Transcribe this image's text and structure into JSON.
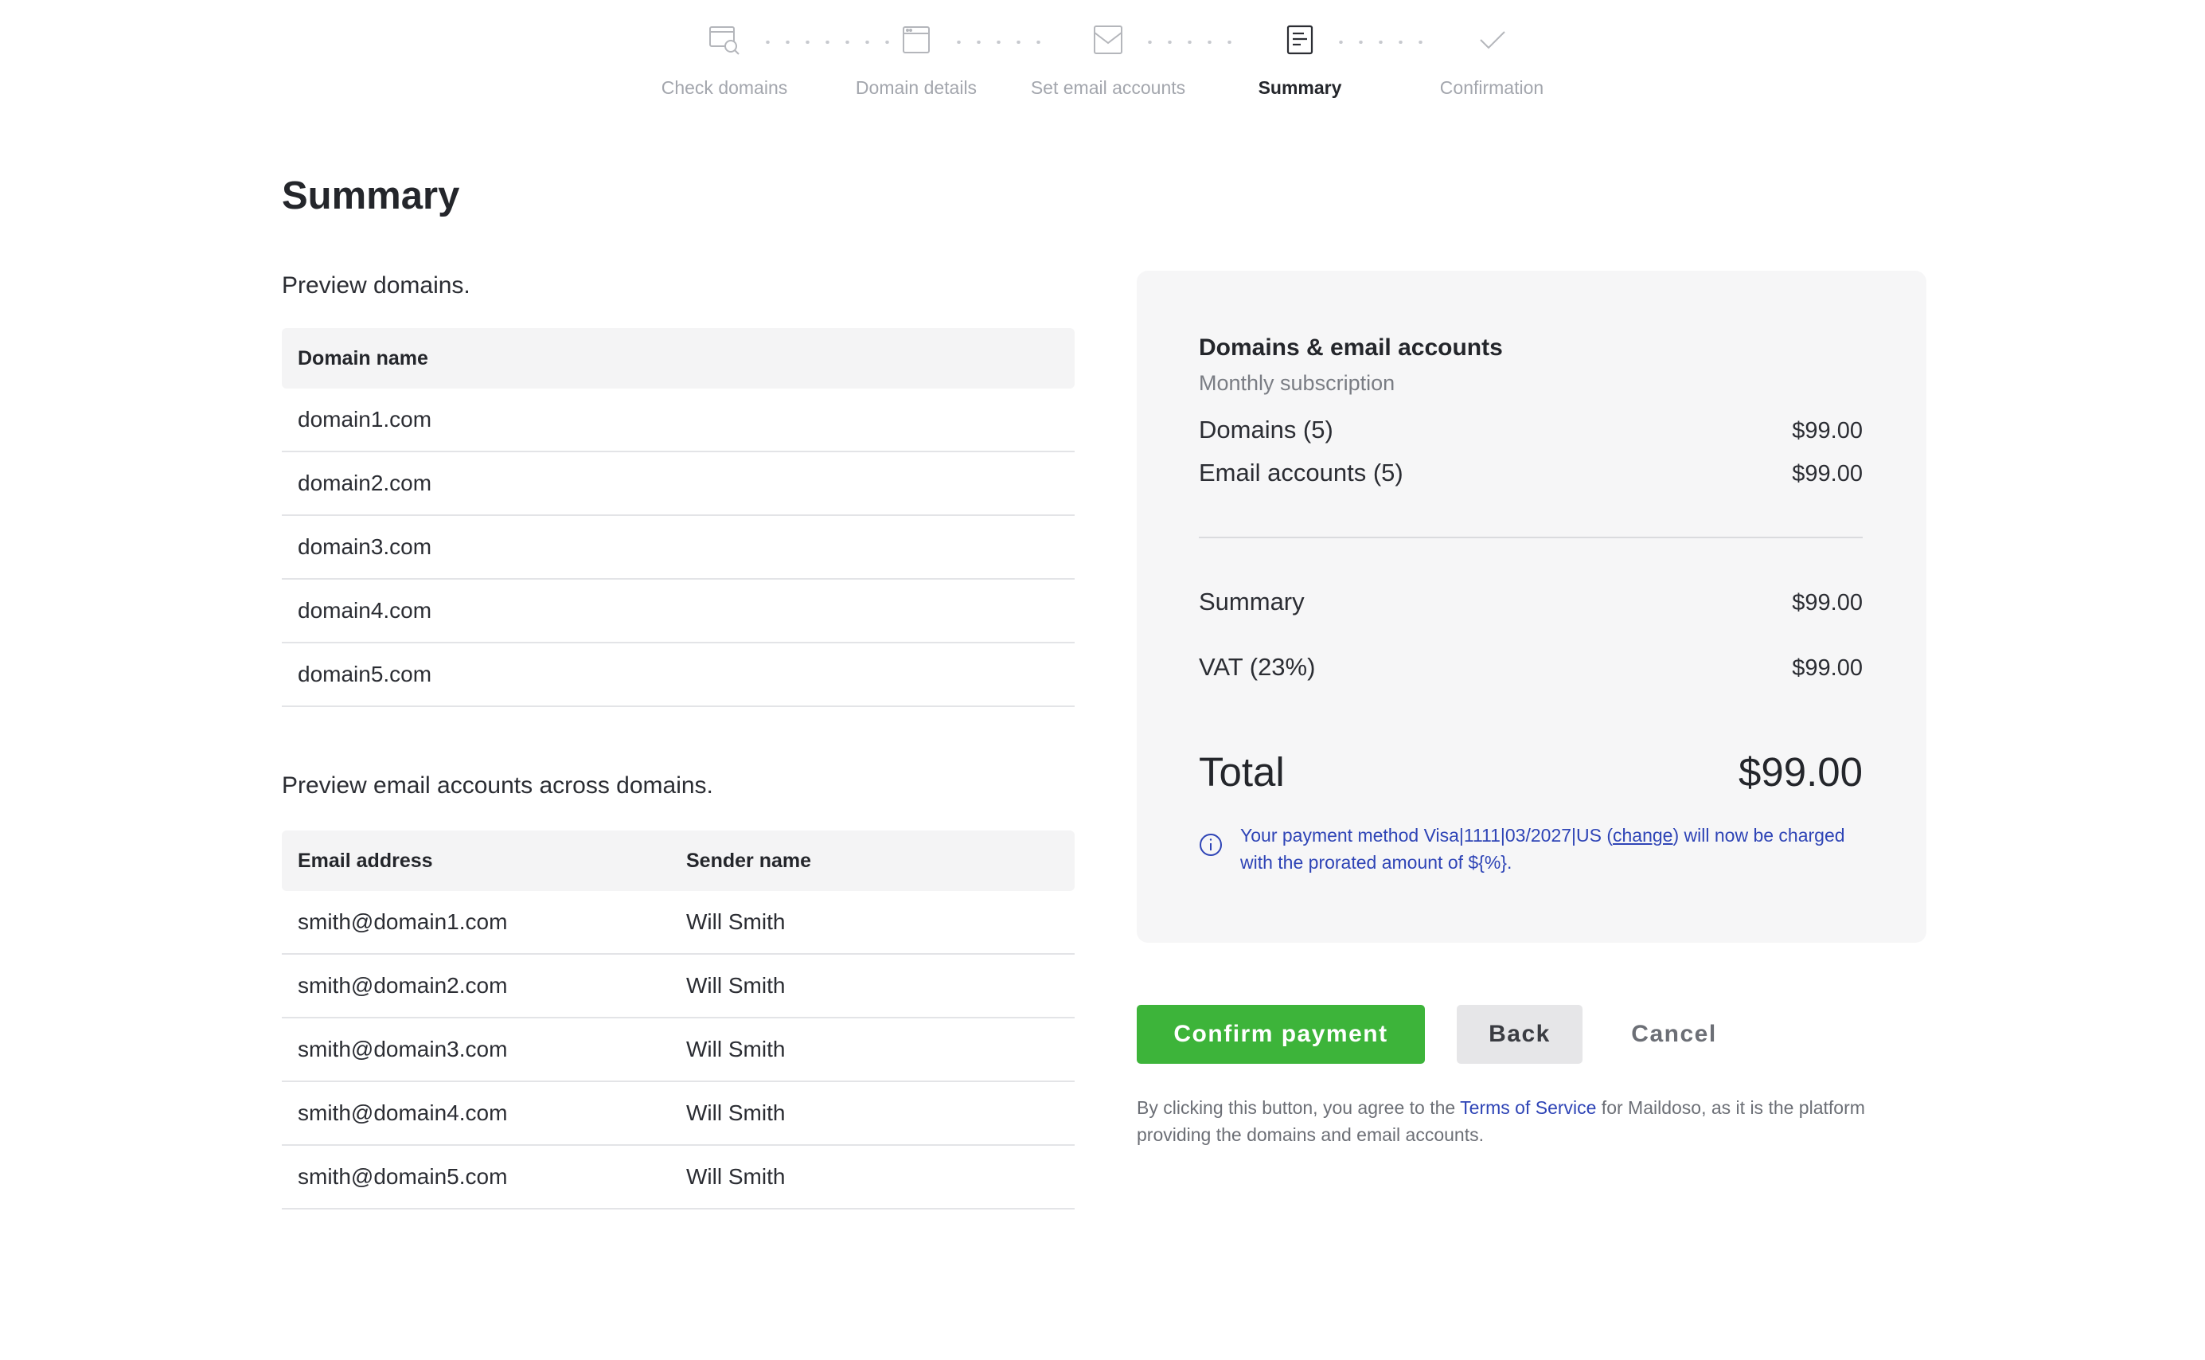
{
  "stepper": {
    "steps": [
      {
        "label": "Check domains",
        "icon": "domain-search-icon",
        "state": "done"
      },
      {
        "label": "Domain details",
        "icon": "browser-window-icon",
        "state": "done"
      },
      {
        "label": "Set email accounts",
        "icon": "mail-icon",
        "state": "done"
      },
      {
        "label": "Summary",
        "icon": "document-icon",
        "state": "active"
      },
      {
        "label": "Confirmation",
        "icon": "checkmark-icon",
        "state": "pending"
      }
    ]
  },
  "page": {
    "title": "Summary"
  },
  "domains_section": {
    "label": "Preview domains.",
    "column_header": "Domain name",
    "rows": [
      "domain1.com",
      "domain2.com",
      "domain3.com",
      "domain4.com",
      "domain5.com"
    ]
  },
  "emails_section": {
    "label": "Preview email accounts across domains.",
    "columns": [
      "Email address",
      "Sender name"
    ],
    "rows": [
      [
        "smith@domain1.com",
        "Will Smith"
      ],
      [
        "smith@domain2.com",
        "Will Smith"
      ],
      [
        "smith@domain3.com",
        "Will Smith"
      ],
      [
        "smith@domain4.com",
        "Will Smith"
      ],
      [
        "smith@domain5.com",
        "Will Smith"
      ]
    ]
  },
  "summary_card": {
    "title": "Domains & email accounts",
    "subtitle": "Monthly subscription",
    "lines": [
      {
        "name": "Domains (5)",
        "amount": "$99.00"
      },
      {
        "name": "Email accounts (5)",
        "amount": "$99.00"
      }
    ],
    "summary": {
      "name": "Summary",
      "amount": "$99.00"
    },
    "vat": {
      "name": "VAT (23%)",
      "amount": "$99.00"
    },
    "total": {
      "name": "Total",
      "amount": "$99.00"
    },
    "notice": {
      "before": "Your payment method Visa|1111|03/2027|US (",
      "link": "change",
      "after": ") will now be charged with the prorated amount of ${%}."
    }
  },
  "actions": {
    "confirm_label": "Confirm payment",
    "back_label": "Back",
    "cancel_label": "Cancel"
  },
  "legal": {
    "before": "By clicking this button, you agree to the ",
    "link": "Terms of Service",
    "after": " for Maildoso, as it is the platform providing the domains and email accounts."
  },
  "colors": {
    "primary": "#3db43a",
    "link": "#2e44b6",
    "card_bg": "#f6f6f7",
    "header_bg": "#f4f4f5"
  }
}
